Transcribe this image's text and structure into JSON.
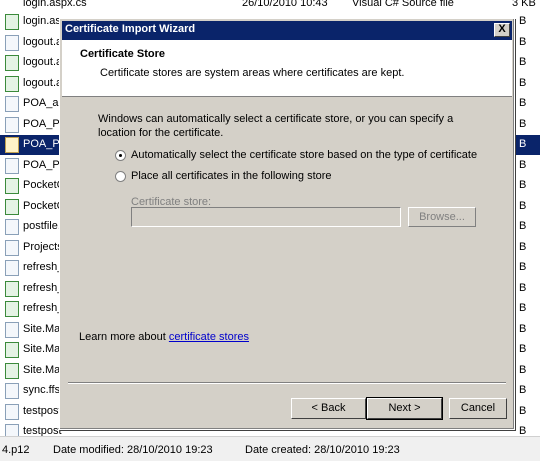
{
  "background": {
    "top_row": {
      "name": "login.aspx.cs",
      "date": "26/10/2010 10:43",
      "type": "Visual C# Source file",
      "size": "3 KB"
    },
    "files": [
      {
        "name": "login.aspx",
        "icon": "cs",
        "size": "B"
      },
      {
        "name": "logout.a",
        "icon": "doc",
        "size": "B"
      },
      {
        "name": "logout.a",
        "icon": "cs",
        "size": "B"
      },
      {
        "name": "logout.a",
        "icon": "cs",
        "size": "B"
      },
      {
        "name": "POA_ad",
        "icon": "doc",
        "size": "B"
      },
      {
        "name": "POA_PR",
        "icon": "doc",
        "size": "B"
      },
      {
        "name": "POA_PR",
        "icon": "cert",
        "size": "B",
        "selected": true
      },
      {
        "name": "POA_PR",
        "icon": "doc",
        "size": "B"
      },
      {
        "name": "PocketC",
        "icon": "cs",
        "size": "B"
      },
      {
        "name": "PocketC",
        "icon": "cs",
        "size": "B"
      },
      {
        "name": "postfile.",
        "icon": "doc",
        "size": "B"
      },
      {
        "name": "Projects",
        "icon": "doc",
        "size": "B"
      },
      {
        "name": "refresh_",
        "icon": "doc",
        "size": "B"
      },
      {
        "name": "refresh_",
        "icon": "cs",
        "size": "B"
      },
      {
        "name": "refresh_",
        "icon": "cs",
        "size": "B"
      },
      {
        "name": "Site.Mas",
        "icon": "doc",
        "size": "B"
      },
      {
        "name": "Site.Mas",
        "icon": "cs",
        "size": "B"
      },
      {
        "name": "Site.Mas",
        "icon": "cs",
        "size": "B"
      },
      {
        "name": "sync.ffs",
        "icon": "doc",
        "size": "B"
      },
      {
        "name": "testpost",
        "icon": "doc",
        "size": "B"
      },
      {
        "name": "testpost",
        "icon": "doc",
        "size": "B"
      }
    ],
    "status": {
      "filename": "4.p12",
      "date_modified": "Date modified: 28/10/2010 19:23",
      "date_created": "Date created: 28/10/2010 19:23"
    }
  },
  "dialog": {
    "title": "Certificate Import Wizard",
    "close": "X",
    "header_title": "Certificate Store",
    "header_subtitle": "Certificate stores are system areas where certificates are kept.",
    "intro": "Windows can automatically select a certificate store, or you can specify a location for the certificate.",
    "option_auto": "Automatically select the certificate store based on the type of certificate",
    "option_manual": "Place all certificates in the following store",
    "selected_option": "auto",
    "store_label": "Certificate store:",
    "store_value": "",
    "browse": "Browse...",
    "learn_prefix": "Learn more about ",
    "learn_link": "certificate stores",
    "back": "< Back",
    "next": "Next >",
    "cancel": "Cancel"
  }
}
